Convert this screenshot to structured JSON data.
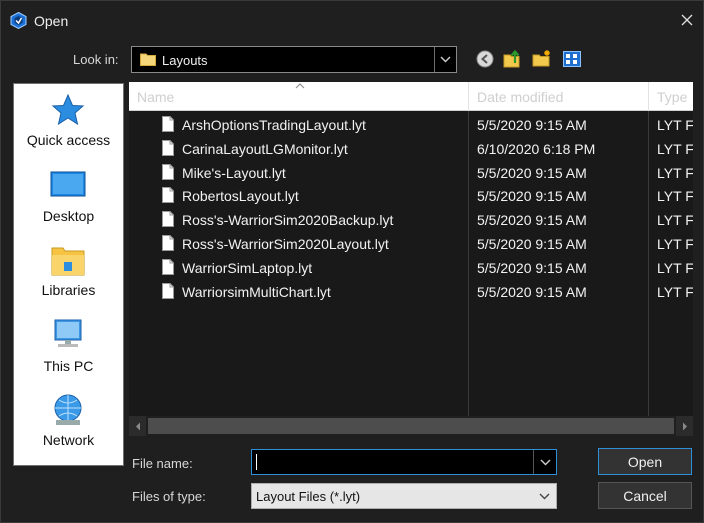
{
  "window": {
    "title": "Open",
    "close_icon": "close-icon"
  },
  "lookin": {
    "label": "Look in:",
    "value": "Layouts"
  },
  "places": [
    {
      "label": "Quick access",
      "icon": "star-icon"
    },
    {
      "label": "Desktop",
      "icon": "desktop-icon"
    },
    {
      "label": "Libraries",
      "icon": "libraries-icon"
    },
    {
      "label": "This PC",
      "icon": "computer-icon"
    },
    {
      "label": "Network",
      "icon": "network-icon"
    }
  ],
  "columns": {
    "name": "Name",
    "date": "Date modified",
    "type": "Type"
  },
  "files": [
    {
      "name": "ArshOptionsTradingLayout.lyt",
      "date": "5/5/2020 9:15 AM",
      "type": "LYT File"
    },
    {
      "name": "CarinaLayoutLGMonitor.lyt",
      "date": "6/10/2020 6:18 PM",
      "type": "LYT File"
    },
    {
      "name": "Mike's-Layout.lyt",
      "date": "5/5/2020 9:15 AM",
      "type": "LYT File"
    },
    {
      "name": "RobertosLayout.lyt",
      "date": "5/5/2020 9:15 AM",
      "type": "LYT File"
    },
    {
      "name": "Ross's-WarriorSim2020Backup.lyt",
      "date": "5/5/2020 9:15 AM",
      "type": "LYT File"
    },
    {
      "name": "Ross's-WarriorSim2020Layout.lyt",
      "date": "5/5/2020 9:15 AM",
      "type": "LYT File"
    },
    {
      "name": "WarriorSimLaptop.lyt",
      "date": "5/5/2020 9:15 AM",
      "type": "LYT File"
    },
    {
      "name": "WarriorsimMultiChart.lyt",
      "date": "5/5/2020 9:15 AM",
      "type": "LYT File"
    }
  ],
  "bottom": {
    "file_name_label": "File name:",
    "file_name_value": "",
    "file_type_label": "Files of type:",
    "file_type_value": "Layout Files (*.lyt)",
    "open_label": "Open",
    "cancel_label": "Cancel"
  },
  "colors": {
    "accent": "#2f8fd8",
    "background": "#1f1f1f",
    "list_background": "#191919"
  }
}
